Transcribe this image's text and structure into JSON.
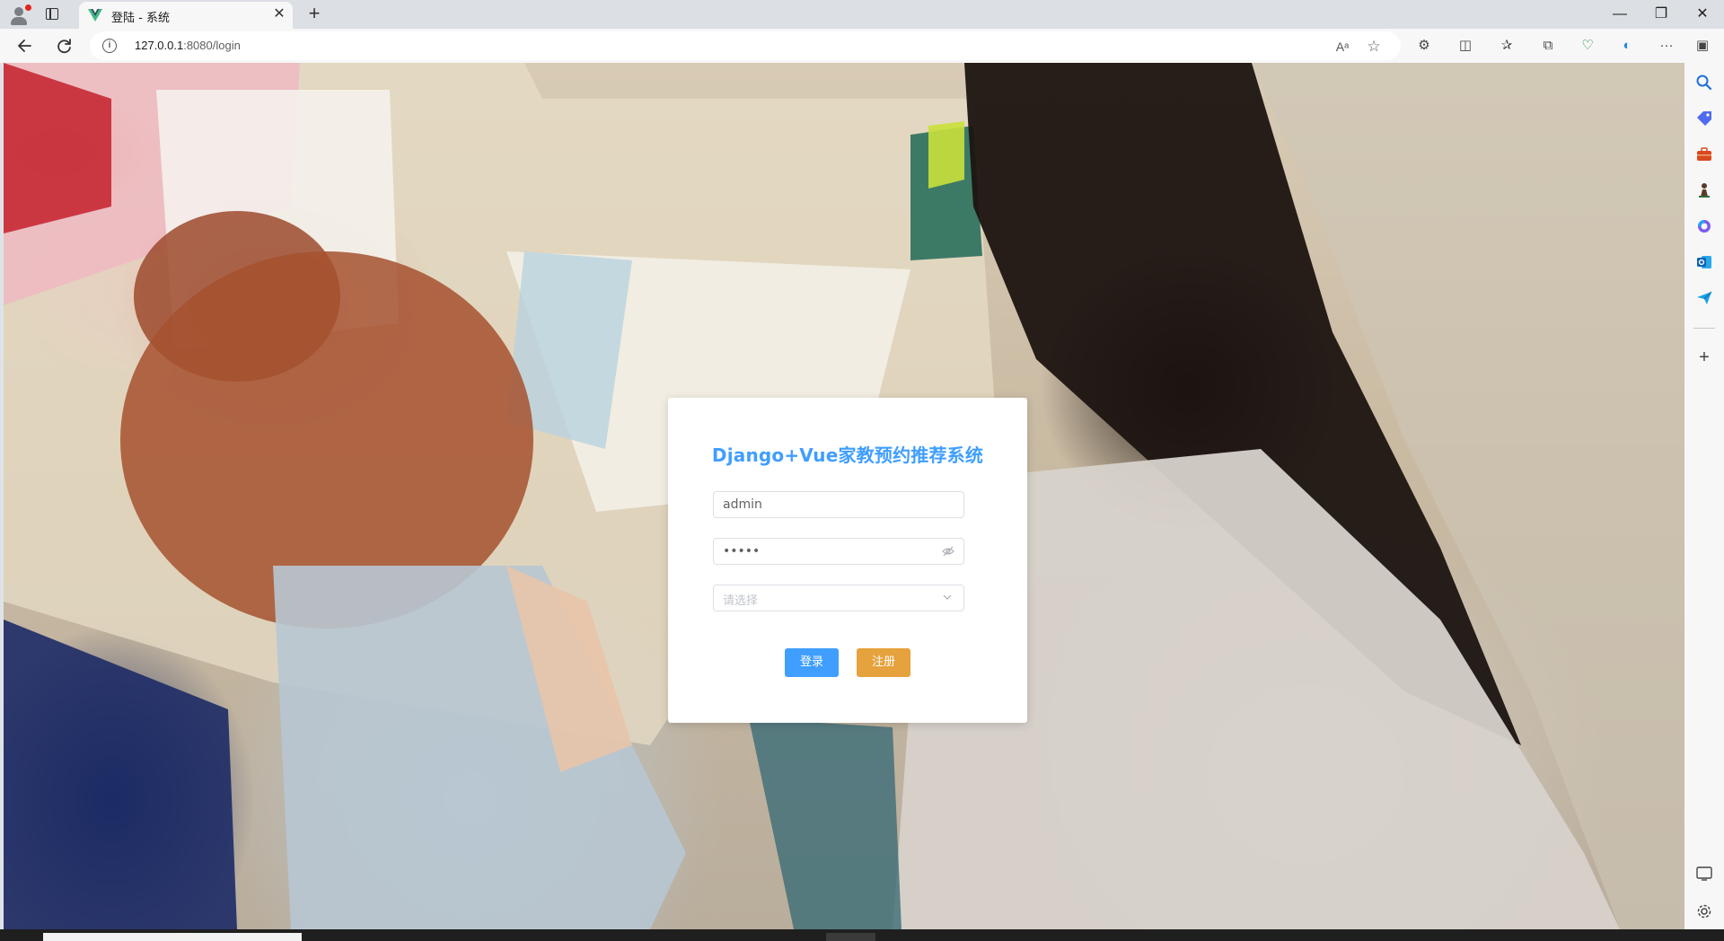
{
  "browser": {
    "tab": {
      "title": "登陆 - 系统",
      "favicon": "vue-logo-icon",
      "favicon_colors": [
        "#41b883",
        "#35495e"
      ]
    },
    "address_bar": {
      "url_host": "127.0.0.1",
      "url_rest": ":8080/login"
    },
    "icons": {
      "profile": "profile-icon",
      "tab_actions": "tab-actions-icon",
      "new_tab": "+",
      "minimize": "—",
      "restore": "❐",
      "close": "✕",
      "back": "back-arrow-icon",
      "refresh": "refresh-icon",
      "site_info": "i",
      "read_aloud": "Aᵃ",
      "favorite": "☆",
      "extensions": "⚙",
      "split_screen": "◫",
      "favorites": "✰",
      "collections": "⧉",
      "browser_essentials": "♡",
      "copilot": "◐",
      "more": "···",
      "sidebar_toggle": "▣"
    }
  },
  "sidebar": {
    "icons": [
      "search-icon",
      "tag-icon",
      "toolbox-icon",
      "chess-icon",
      "microsoft365-icon",
      "outlook-icon",
      "send-icon",
      "add-icon",
      "screenshot-icon",
      "settings-icon"
    ],
    "add_label": "+"
  },
  "login": {
    "title": "Django+Vue家教预约推荐系统",
    "username_value": "admin",
    "password_value": "admin",
    "role_placeholder": "请选择",
    "login_button": "登录",
    "register_button": "注册",
    "colors": {
      "primary": "#409eff",
      "warning": "#e6a23c"
    }
  }
}
